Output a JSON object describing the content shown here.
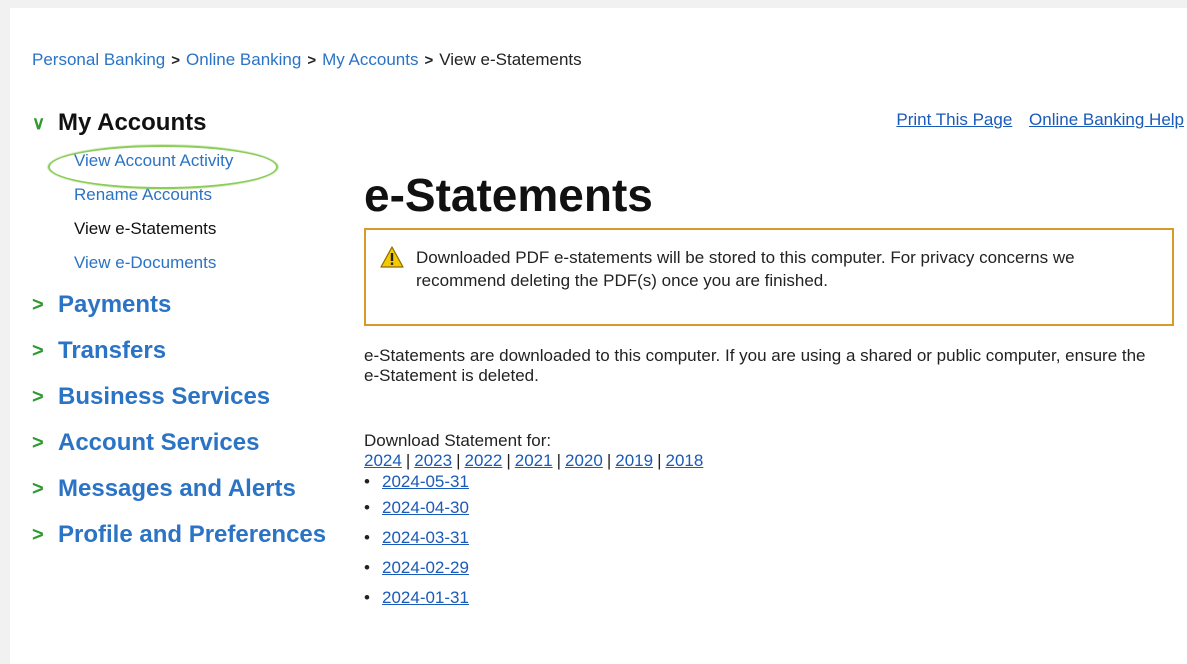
{
  "breadcrumb": {
    "items": [
      "Personal Banking",
      "Online Banking",
      "My Accounts"
    ],
    "separator": ">",
    "current": "View e-Statements"
  },
  "sidebar": {
    "open_section": {
      "label": "My Accounts",
      "chevron": "∨",
      "items": [
        {
          "label": "View Account Activity"
        },
        {
          "label": "Rename Accounts"
        },
        {
          "label": "View e-Statements"
        },
        {
          "label": "View e-Documents"
        }
      ]
    },
    "closed_chevron": ">",
    "closed_sections": [
      {
        "label": "Payments"
      },
      {
        "label": "Transfers"
      },
      {
        "label": "Business Services"
      },
      {
        "label": "Account Services"
      },
      {
        "label": "Messages and Alerts"
      },
      {
        "label": "Profile and Preferences"
      }
    ]
  },
  "top_links": {
    "print": "Print This Page",
    "help": "Online Banking Help"
  },
  "title": "e-Statements",
  "notice": {
    "icon": "warning-icon",
    "text": "Downloaded PDF e-statements will be stored to this computer. For privacy concerns we recommend deleting the PDF(s) once you are finished."
  },
  "info_text": "e-Statements are downloaded to this computer. If you are using a shared or public computer, ensure the e-Statement is deleted.",
  "download": {
    "label": "Download Statement for:",
    "years": [
      "2024",
      "2023",
      "2022",
      "2021",
      "2020",
      "2019",
      "2018"
    ],
    "year_separator": "|",
    "statements": [
      "2024-05-31",
      "2024-04-30",
      "2024-03-31",
      "2024-02-29",
      "2024-01-31"
    ],
    "bullet": "•"
  },
  "colors": {
    "link": "#2a73c5",
    "chevron": "#2f9a2f",
    "notice_border": "#d89a2a",
    "highlight_circle": "#8ccc5a"
  }
}
